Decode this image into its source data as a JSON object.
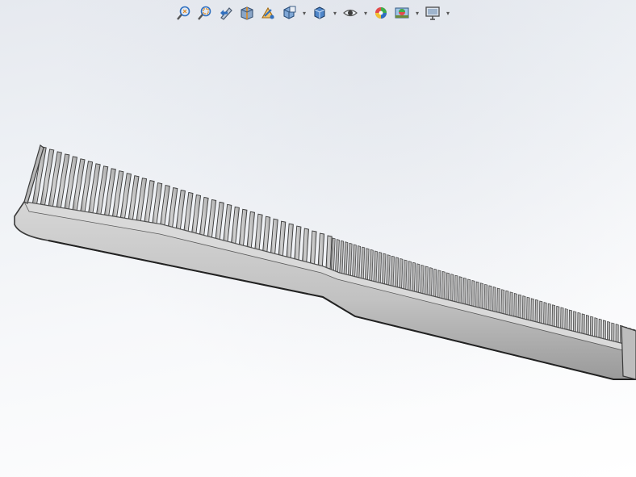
{
  "app": {
    "view": "solidworks-graphics-area"
  },
  "colors": {
    "background_top": "#e6e9ef",
    "background_bottom": "#ffffff",
    "model_fill": "#c4c4c4",
    "model_edge": "#3a3a3a",
    "icon_blue": "#2f6fbf",
    "icon_orange": "#e08a1e"
  },
  "toolbar": {
    "items": [
      {
        "icon": "zoom-to-fit-icon",
        "dropdown": false
      },
      {
        "icon": "zoom-to-area-icon",
        "dropdown": false
      },
      {
        "icon": "previous-view-icon",
        "dropdown": false
      },
      {
        "icon": "section-view-icon",
        "dropdown": false
      },
      {
        "icon": "dynamic-annotation-views-icon",
        "dropdown": false
      },
      {
        "icon": "view-orientation-icon",
        "dropdown": true
      },
      {
        "icon": "display-style-icon",
        "dropdown": true
      },
      {
        "icon": "hide-show-items-icon",
        "dropdown": true
      },
      {
        "icon": "edit-appearance-icon",
        "dropdown": false
      },
      {
        "icon": "apply-scene-icon",
        "dropdown": true
      },
      {
        "icon": "view-settings-icon",
        "dropdown": true
      }
    ]
  },
  "model": {
    "name": "comb",
    "wide_teeth_count": 38,
    "fine_teeth_count": 72
  }
}
